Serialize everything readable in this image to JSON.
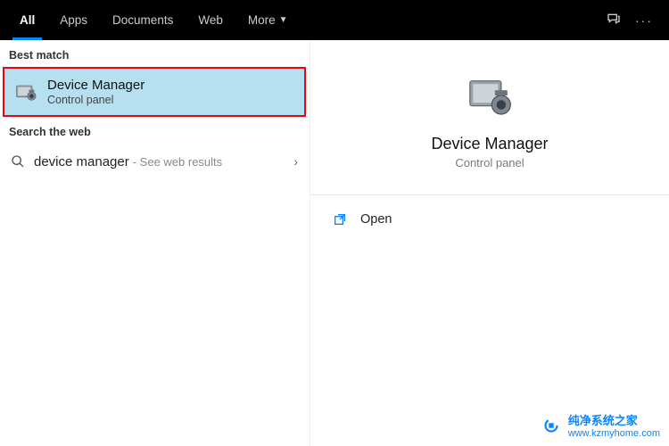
{
  "tabs": {
    "all": "All",
    "apps": "Apps",
    "documents": "Documents",
    "web": "Web",
    "more": "More"
  },
  "left": {
    "best_match_label": "Best match",
    "best_match": {
      "title": "Device Manager",
      "subtitle": "Control panel"
    },
    "search_web_label": "Search the web",
    "web_item": {
      "query": "device manager",
      "hint": "- See web results"
    }
  },
  "right": {
    "title": "Device Manager",
    "subtitle": "Control panel",
    "open_label": "Open"
  },
  "watermark": {
    "line1": "纯净系统之家",
    "line2": "www.kzmyhome.com"
  }
}
